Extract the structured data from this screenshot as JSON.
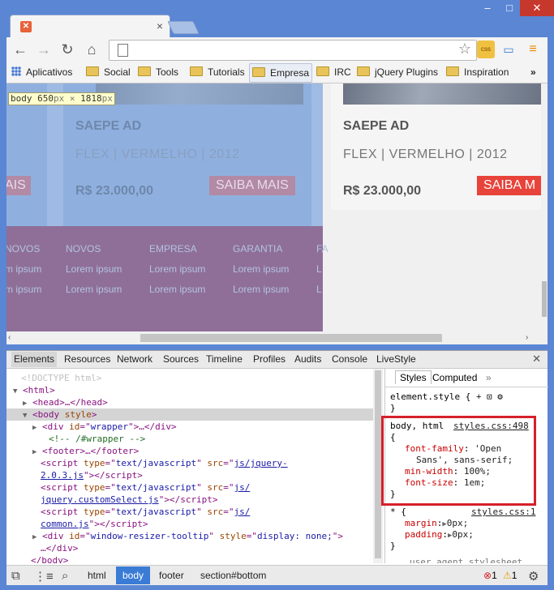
{
  "browser": {
    "tab_icon": "xampp-favicon",
    "window_controls": {
      "minimize": "–",
      "maximize": "□",
      "close": "✕"
    },
    "bookmarks": [
      {
        "label": "Aplicativos",
        "icon": "apps-grid-icon"
      },
      {
        "label": "Social",
        "icon": "folder-icon"
      },
      {
        "label": "Tools",
        "icon": "folder-icon"
      },
      {
        "label": "Tutorials",
        "icon": "folder-icon"
      },
      {
        "label": "Empresa",
        "icon": "folder-icon"
      },
      {
        "label": "IRC",
        "icon": "folder-icon"
      },
      {
        "label": "jQuery Plugins",
        "icon": "folder-icon"
      },
      {
        "label": "Inspiration",
        "icon": "folder-icon"
      }
    ],
    "bookmarks_more": "»"
  },
  "page": {
    "tooltip": {
      "tag": "body",
      "width": "650",
      "w_unit": "px",
      "times": "×",
      "height": "1818",
      "h_unit": "px"
    },
    "left_card": {
      "title": "SAEPE AD",
      "subtitle": "FLEX | VERMELHO | 2012",
      "price": "R$ 23.000,00",
      "button": "SAIBA MAIS"
    },
    "left_partial_button": "AIS",
    "right_card": {
      "title": "SAEPE AD",
      "subtitle": "FLEX | VERMELHO | 2012",
      "price": "R$ 23.000,00",
      "button": "SAIBA M"
    },
    "footer_cols": [
      {
        "heading": "NOVOS",
        "items": [
          "m ipsum",
          "m ipsum"
        ]
      },
      {
        "heading": "NOVOS",
        "items": [
          "Lorem ipsum",
          "Lorem ipsum"
        ]
      },
      {
        "heading": "EMPRESA",
        "items": [
          "Lorem ipsum",
          "Lorem ipsum"
        ]
      },
      {
        "heading": "GARANTIA",
        "items": [
          "Lorem ipsum",
          "Lorem ipsum"
        ]
      },
      {
        "heading": "FA",
        "items": [
          "L",
          "L"
        ]
      }
    ]
  },
  "devtools": {
    "tabs": [
      "Elements",
      "Resources",
      "Network",
      "Sources",
      "Timeline",
      "Profiles",
      "Audits",
      "Console",
      "LiveStyle"
    ],
    "close": "✕",
    "dom": {
      "doctype": "<!DOCTYPE html>",
      "html_open": "<html>",
      "head": "<head>…</head>",
      "body_tag": "body",
      "body_attr": "style",
      "wrapper_id": "wrapper",
      "comment": "<!-- /#wrapper -->",
      "footer": "<footer>…</footer>",
      "script1_src": [
        "js/jquery-",
        "2.0.3.js"
      ],
      "script2_src": [
        "js/",
        "jquery.customSelect.js"
      ],
      "script3_src": [
        "js/",
        "common.js"
      ],
      "resizer_id": "window-resizer-tooltip",
      "resizer_style": "display: none;",
      "resizer_close": "…</div>",
      "body_close": "</body>"
    },
    "styles_tabs": [
      "Styles",
      "Computed"
    ],
    "styles_more": "»",
    "element_style": "element.style {",
    "rule1": {
      "selector": "body, html",
      "source": "styles.css:498",
      "props": [
        {
          "name": "font-family",
          "value": "'Open"
        },
        {
          "name": "",
          "value": "Sans', sans-serif;"
        },
        {
          "name": "min-width",
          "value": "100%;"
        },
        {
          "name": "font-size",
          "value": "1em;"
        }
      ]
    },
    "rule2": {
      "selector": "* {",
      "source": "styles.css:1",
      "props": [
        {
          "name": "margin",
          "value": "0px;"
        },
        {
          "name": "padding",
          "value": "0px;"
        }
      ]
    },
    "rule3_partial": "user agent stylesheet",
    "breadcrumbs": [
      "html",
      "body",
      "footer",
      "section#bottom"
    ],
    "errors": "1",
    "warnings": "1"
  }
}
